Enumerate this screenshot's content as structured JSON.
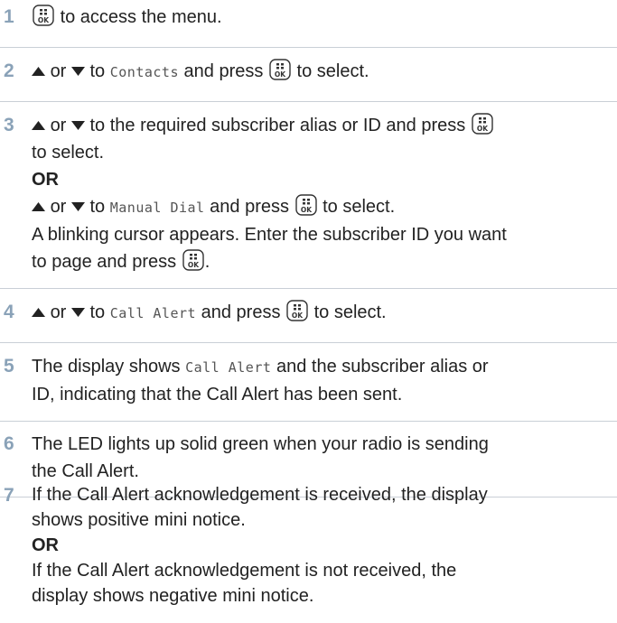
{
  "steps": [
    {
      "n": "1",
      "t_after_ok": "to access the menu."
    },
    {
      "n": "2",
      "t_or": "or",
      "t_to": "to",
      "mono": "Contacts",
      "t_press": "and press",
      "t_select": "to select."
    },
    {
      "n": "3",
      "l1_or": "or",
      "l1_to": "to the required subscriber alias or ID and press",
      "l2": "to select.",
      "l3": "OR",
      "l4_or": "or",
      "l4_to": "to",
      "l4_mono": "Manual Dial",
      "l4_press": "and press",
      "l4_select": "to select.",
      "l5": "A blinking cursor appears. Enter the subscriber ID you want",
      "l6": "to page and press",
      "l6_end": "."
    },
    {
      "n": "4",
      "t_or": "or",
      "t_to": "to",
      "mono": "Call Alert",
      "t_press": "and press",
      "t_select": "to select."
    },
    {
      "n": "5",
      "l1_a": "The display shows",
      "l1_mono": "Call Alert",
      "l1_b": "and the subscriber alias or",
      "l2": "ID, indicating that the Call Alert has been sent."
    },
    {
      "n": "6",
      "l1": "The LED lights up solid green when your radio is sending",
      "l2": "the Call Alert."
    },
    {
      "n": "7",
      "l1": "If the Call Alert acknowledgement is received, the display",
      "l2": "shows  positive mini notice.",
      "l3": "OR",
      "l4": "If the Call Alert acknowledgement is not received, the",
      "l5": "display shows  negative mini notice."
    }
  ],
  "icons": {
    "ok": "menu-ok-button-icon",
    "up": "up-arrow-icon",
    "down": "down-arrow-icon"
  },
  "colors": {
    "step_number": "#8aa2b8",
    "separator": "#c9cfd6",
    "text": "#222222"
  }
}
